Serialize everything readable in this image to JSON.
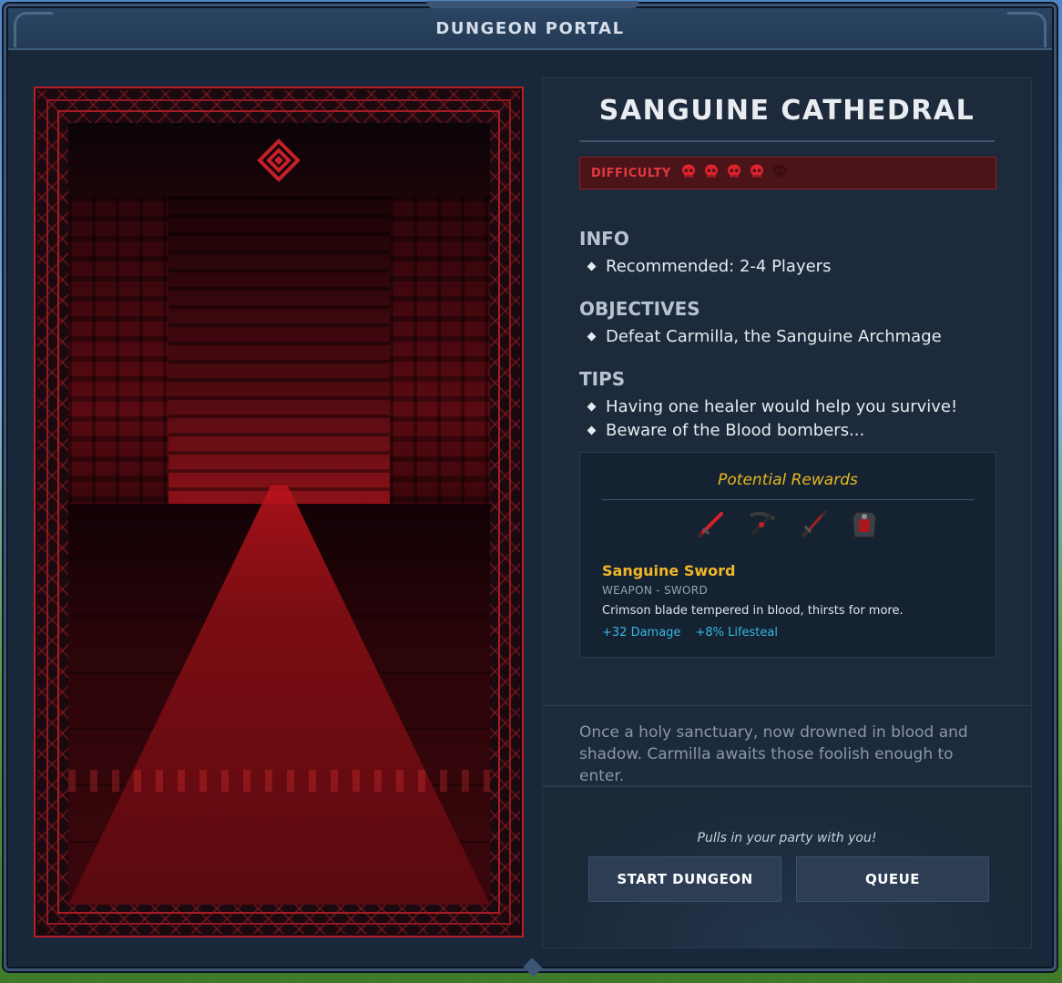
{
  "window": {
    "title": "DUNGEON PORTAL"
  },
  "dungeon": {
    "name": "SANGUINE CATHEDRAL",
    "difficulty_label": "DIFFICULTY",
    "difficulty_level": 4,
    "difficulty_max": 5
  },
  "info": {
    "title": "INFO",
    "items": [
      "Recommended: 2-4 Players"
    ]
  },
  "objectives": {
    "title": "OBJECTIVES",
    "items": [
      "Defeat Carmilla, the Sanguine Archmage"
    ]
  },
  "tips": {
    "title": "TIPS",
    "items": [
      "Having one healer would help you survive!",
      "Beware of the Blood bombers..."
    ]
  },
  "rewards": {
    "title": "Potential Rewards",
    "items": [
      "sword-icon",
      "crossbow-icon",
      "dagger-icon",
      "armor-icon"
    ],
    "selected": {
      "name": "Sanguine Sword",
      "type": "WEAPON - SWORD",
      "description": "Crimson blade tempered in blood, thirsts for more.",
      "stats": [
        "+32 Damage",
        "+8% Lifesteal"
      ]
    }
  },
  "lore": "Once a holy sanctuary, now drowned in blood and shadow. Carmilla awaits those foolish enough to enter.",
  "footer": {
    "hint": "Pulls in your party with you!",
    "start_label": "START DUNGEON",
    "queue_label": "QUEUE"
  },
  "colors": {
    "accent_red": "#c4202a",
    "gold": "#e6b81c",
    "stat_blue": "#35b8e0"
  }
}
